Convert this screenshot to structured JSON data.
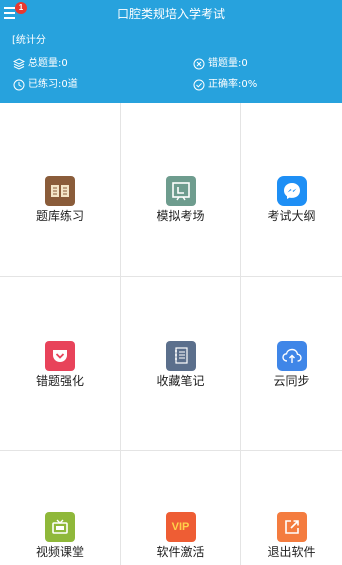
{
  "header": {
    "title": "口腔类规培入学考试",
    "menu_badge": "1",
    "stats_heading": "[统计分",
    "stats": [
      {
        "icon": "layers-icon",
        "text": "总题量:0"
      },
      {
        "icon": "circle-x-icon",
        "text": "错题量:0"
      },
      {
        "icon": "clock-icon",
        "text": "已练习:0道"
      },
      {
        "icon": "circle-check-icon",
        "text": "正确率:0%"
      }
    ]
  },
  "grid": {
    "items": [
      {
        "label": "题库练习",
        "icon": "open-book-icon",
        "color": "#8a5c3a"
      },
      {
        "label": "模拟考场",
        "icon": "exam-board-icon",
        "color": "#6e9c8e"
      },
      {
        "label": "考试大纲",
        "icon": "messenger-icon",
        "color": "#1e8ff5"
      },
      {
        "label": "错题强化",
        "icon": "pocket-icon",
        "color": "#e8435a"
      },
      {
        "label": "收藏笔记",
        "icon": "notebook-icon",
        "color": "#5b6f8c"
      },
      {
        "label": "云同步",
        "icon": "cloud-upload-icon",
        "color": "#3f86e8"
      },
      {
        "label": "视频课堂",
        "icon": "tv-icon",
        "color": "#8fb83a"
      },
      {
        "label": "软件激活",
        "icon": "vip-icon",
        "color": "#ee5d34",
        "icon_text": "VIP"
      },
      {
        "label": "退出软件",
        "icon": "exit-icon",
        "color": "#f47c3f"
      }
    ]
  }
}
